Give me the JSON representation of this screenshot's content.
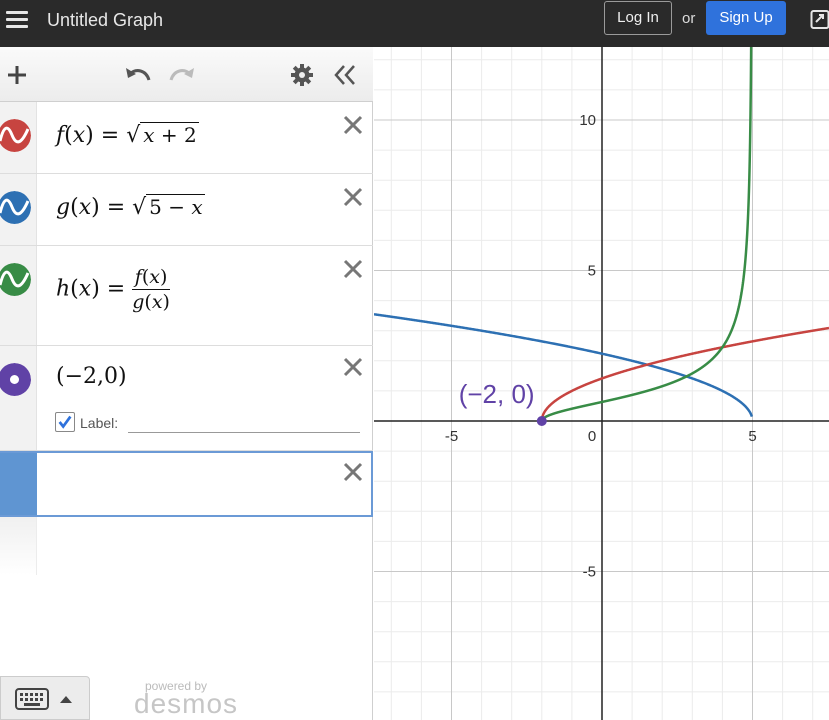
{
  "header": {
    "title": "Untitled Graph",
    "login_label": "Log In",
    "or_label": "or",
    "signup_label": "Sign Up"
  },
  "toolbar": {
    "icons": [
      "add-icon",
      "undo-icon",
      "redo-icon",
      "gear-icon",
      "collapse-icon"
    ]
  },
  "expressions": [
    {
      "color": "#c74440",
      "latex": "f(x) = √(x + 2)"
    },
    {
      "color": "#2d70b3",
      "latex": "g(x) = √(5 − x)"
    },
    {
      "color": "#388c46",
      "latex": "h(x) = f(x) / g(x)"
    },
    {
      "color": "#6042a6",
      "latex": "(−2,0)",
      "label_checkbox": "Label:",
      "label_checked": true
    }
  ],
  "footer": {
    "powered_by": "powered by",
    "brand": "desmos"
  },
  "graph": {
    "x_ticks": [
      "-5",
      "0",
      "5"
    ],
    "y_ticks": [
      "10",
      "5",
      "-5"
    ],
    "point_label": "(−2, 0)",
    "colors": {
      "f": "#c74440",
      "g": "#2d70b3",
      "h": "#388c46",
      "point": "#6042a6"
    }
  }
}
